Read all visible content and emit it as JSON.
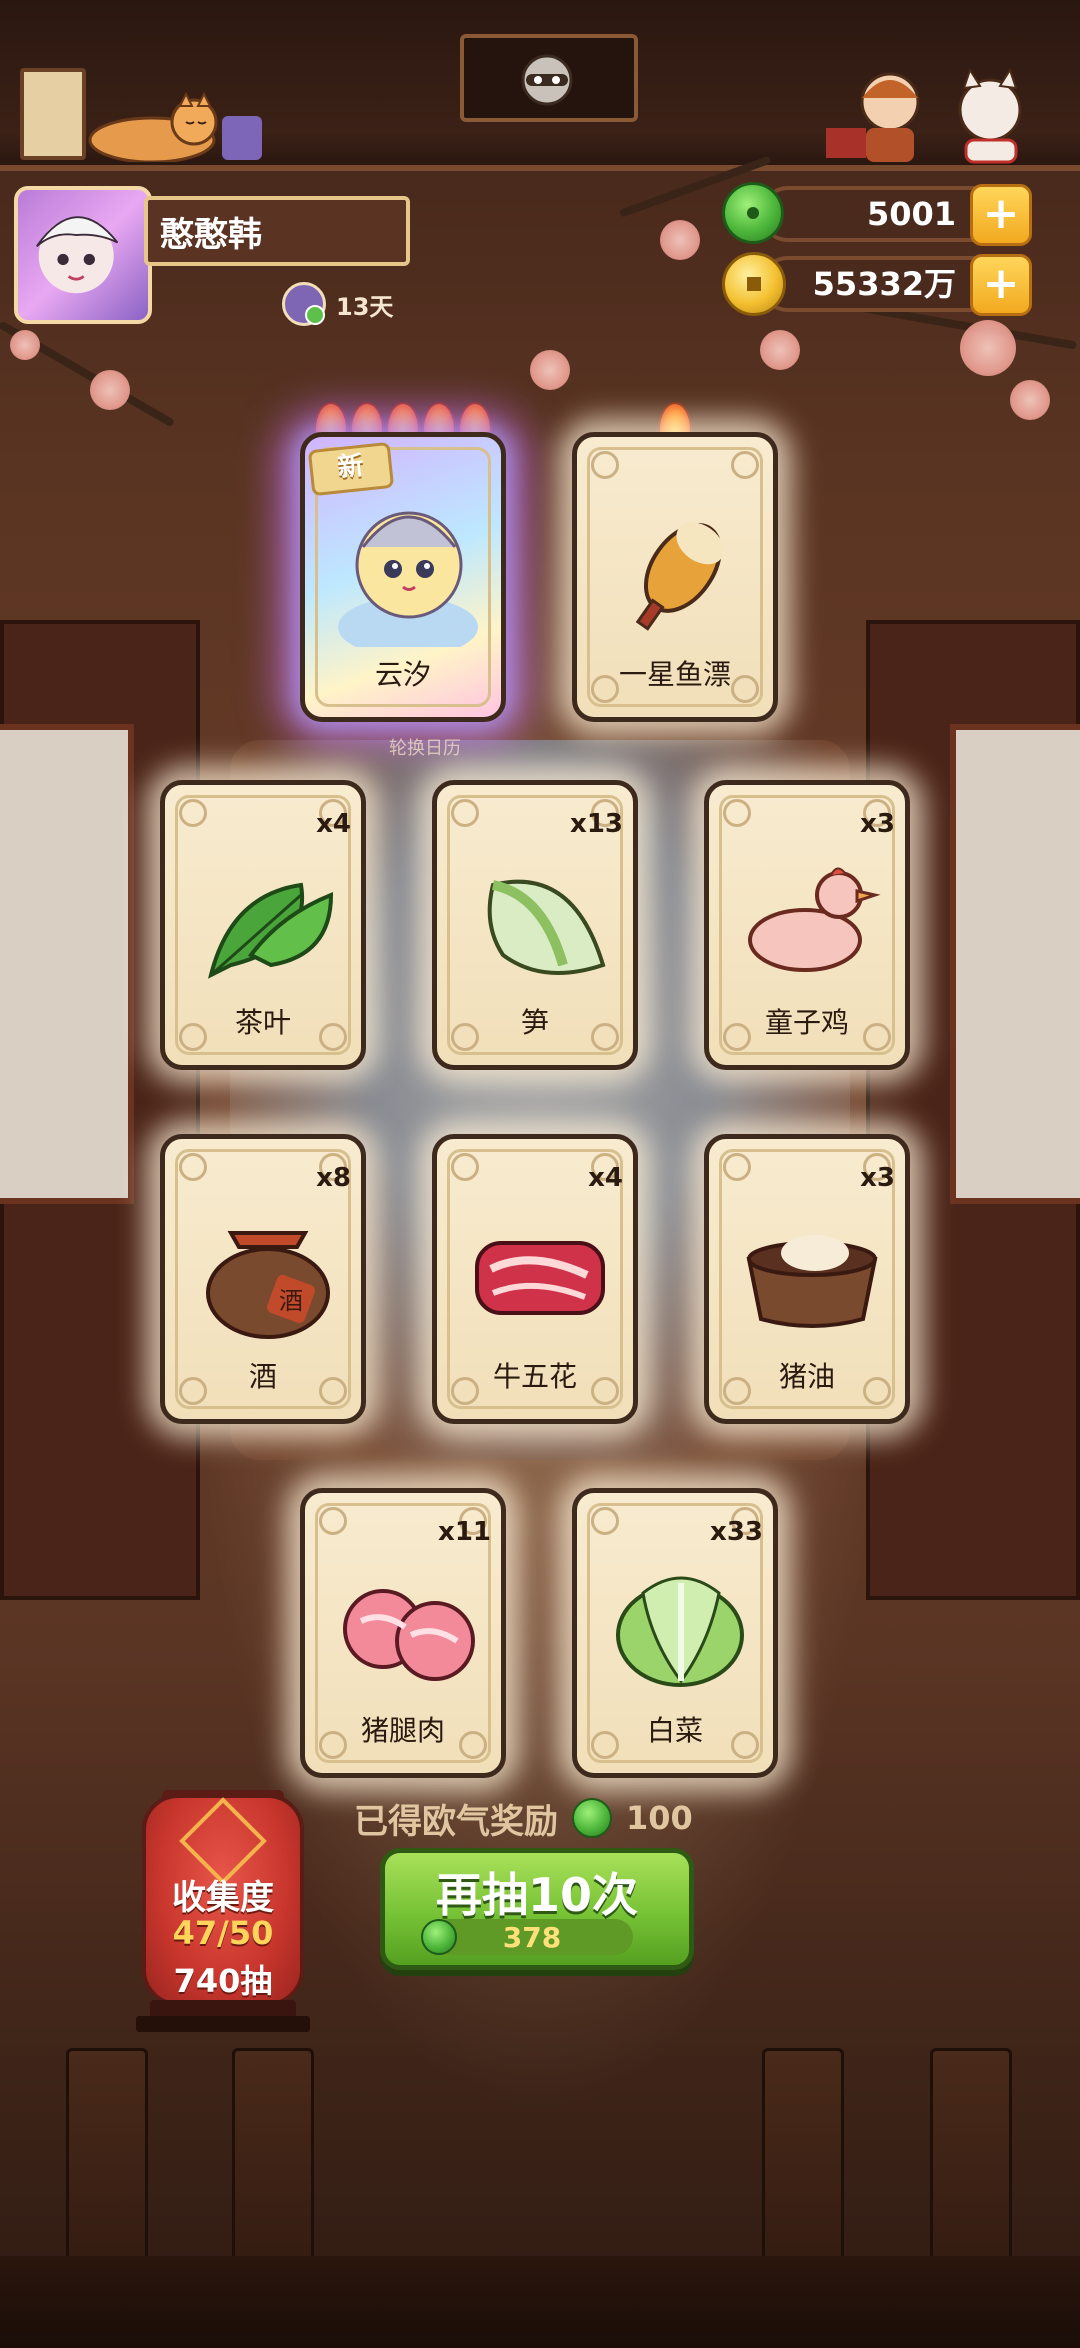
{
  "player": {
    "name": "憨憨韩",
    "days": "13天"
  },
  "currencies": {
    "jade": "5001",
    "gold": "55332万",
    "add_symbol": "+"
  },
  "featured": [
    {
      "label": "云汐",
      "tag": "新",
      "flames": 5,
      "icon": "girl-character-icon"
    },
    {
      "label": "一星鱼漂",
      "flames": 1,
      "icon": "fishing-float-icon"
    }
  ],
  "rotate_calendar": "轮换日历",
  "cards": [
    {
      "label": "茶叶",
      "count": "x4",
      "icon": "tea-leaf-icon"
    },
    {
      "label": "笋",
      "count": "x13",
      "icon": "bamboo-shoot-icon"
    },
    {
      "label": "童子鸡",
      "count": "x3",
      "icon": "chicken-icon"
    },
    {
      "label": "酒",
      "count": "x8",
      "icon": "wine-jar-icon",
      "jar_text": "酒"
    },
    {
      "label": "牛五花",
      "count": "x4",
      "icon": "beef-icon"
    },
    {
      "label": "猪油",
      "count": "x3",
      "icon": "lard-icon"
    },
    {
      "label": "猪腿肉",
      "count": "x11",
      "icon": "pork-leg-icon"
    },
    {
      "label": "白菜",
      "count": "x33",
      "icon": "cabbage-icon"
    }
  ],
  "reward": {
    "label": "已得欧气奖励",
    "value": "100"
  },
  "draw_button": {
    "label": "再抽10次",
    "cost": "378"
  },
  "collection": {
    "title": "收集度",
    "progress": "47/50",
    "draws": "740抽"
  },
  "colors": {
    "accent_green": "#76c235",
    "gold": "#f4c030",
    "lantern_red": "#c7352c",
    "card_bg": "#f1dfb9"
  }
}
